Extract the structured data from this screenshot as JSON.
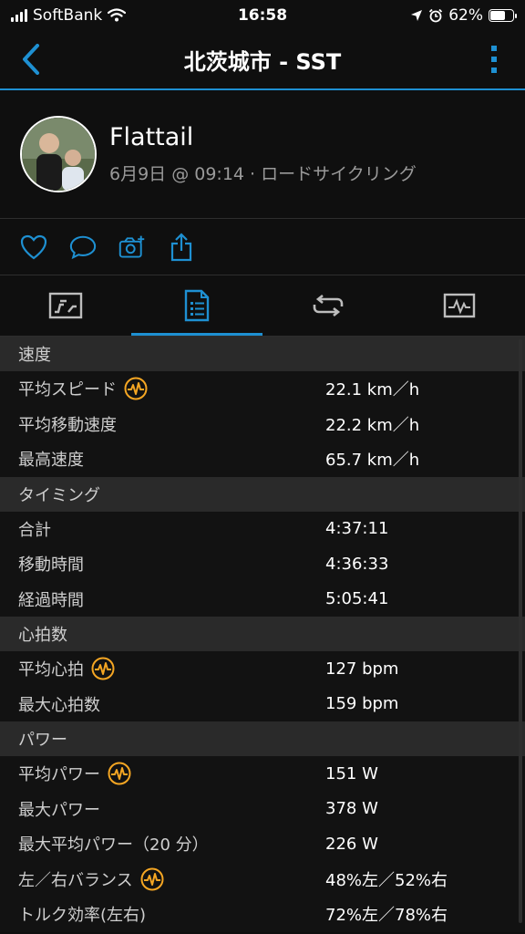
{
  "status": {
    "carrier": "SoftBank",
    "time": "16:58",
    "battery": "62%",
    "battery_level": 0.62
  },
  "nav": {
    "title": "北茨城市 - SST"
  },
  "profile": {
    "name": "Flattail",
    "meta": "6月9日 @ 09:14 · ロードサイクリング"
  },
  "colors": {
    "accent": "#1e90d2",
    "power": "#f5a623"
  },
  "tabs": [
    "summary-tab",
    "stats-tab",
    "laps-tab",
    "charts-tab"
  ],
  "sections": [
    {
      "title": "速度",
      "rows": [
        {
          "label": "平均スピード",
          "value": "22.1 km／h",
          "icon": true
        },
        {
          "label": "平均移動速度",
          "value": "22.2 km／h",
          "icon": false
        },
        {
          "label": "最高速度",
          "value": "65.7 km／h",
          "icon": false
        }
      ]
    },
    {
      "title": "タイミング",
      "rows": [
        {
          "label": "合計",
          "value": "4:37:11",
          "icon": false
        },
        {
          "label": "移動時間",
          "value": "4:36:33",
          "icon": false
        },
        {
          "label": "経過時間",
          "value": "5:05:41",
          "icon": false
        }
      ]
    },
    {
      "title": "心拍数",
      "rows": [
        {
          "label": "平均心拍",
          "value": "127 bpm",
          "icon": true
        },
        {
          "label": "最大心拍数",
          "value": "159 bpm",
          "icon": false
        }
      ]
    },
    {
      "title": "パワー",
      "rows": [
        {
          "label": "平均パワー",
          "value": "151 W",
          "icon": true
        },
        {
          "label": "最大パワー",
          "value": "378 W",
          "icon": false
        },
        {
          "label": "最大平均パワー（20 分）",
          "value": "226 W",
          "icon": false
        },
        {
          "label": "左／右バランス",
          "value": "48%左／52%右",
          "icon": true
        },
        {
          "label": "トルク効率(左右)",
          "value": "72%左／78%右",
          "icon": false
        }
      ]
    }
  ]
}
